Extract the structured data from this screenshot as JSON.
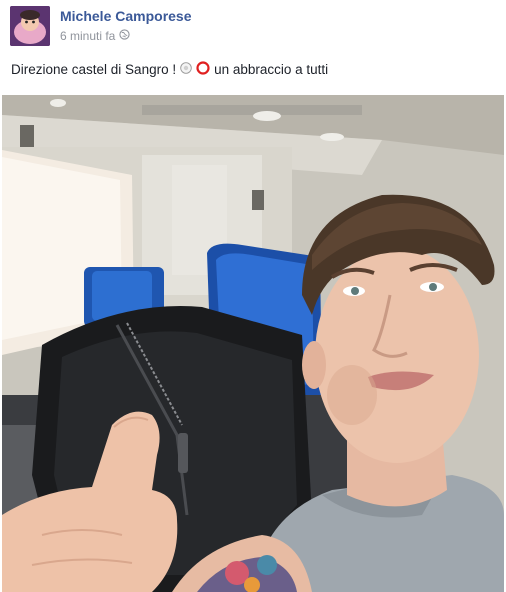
{
  "post": {
    "author_name": "Michele Camporese",
    "timestamp": "6 minuti fa",
    "privacy_icon": "globe-icon",
    "status_before_emoji": "Direzione castel di Sangro !",
    "emojis": [
      "soccer-ball-emoji",
      "red-circle-emoji"
    ],
    "status_after_emoji": "un abbraccio a tutti",
    "photo_subject": "selfie-photo"
  },
  "colors": {
    "author_link": "#3b5998",
    "meta_text": "#90949c",
    "body_text": "#1d2129"
  }
}
